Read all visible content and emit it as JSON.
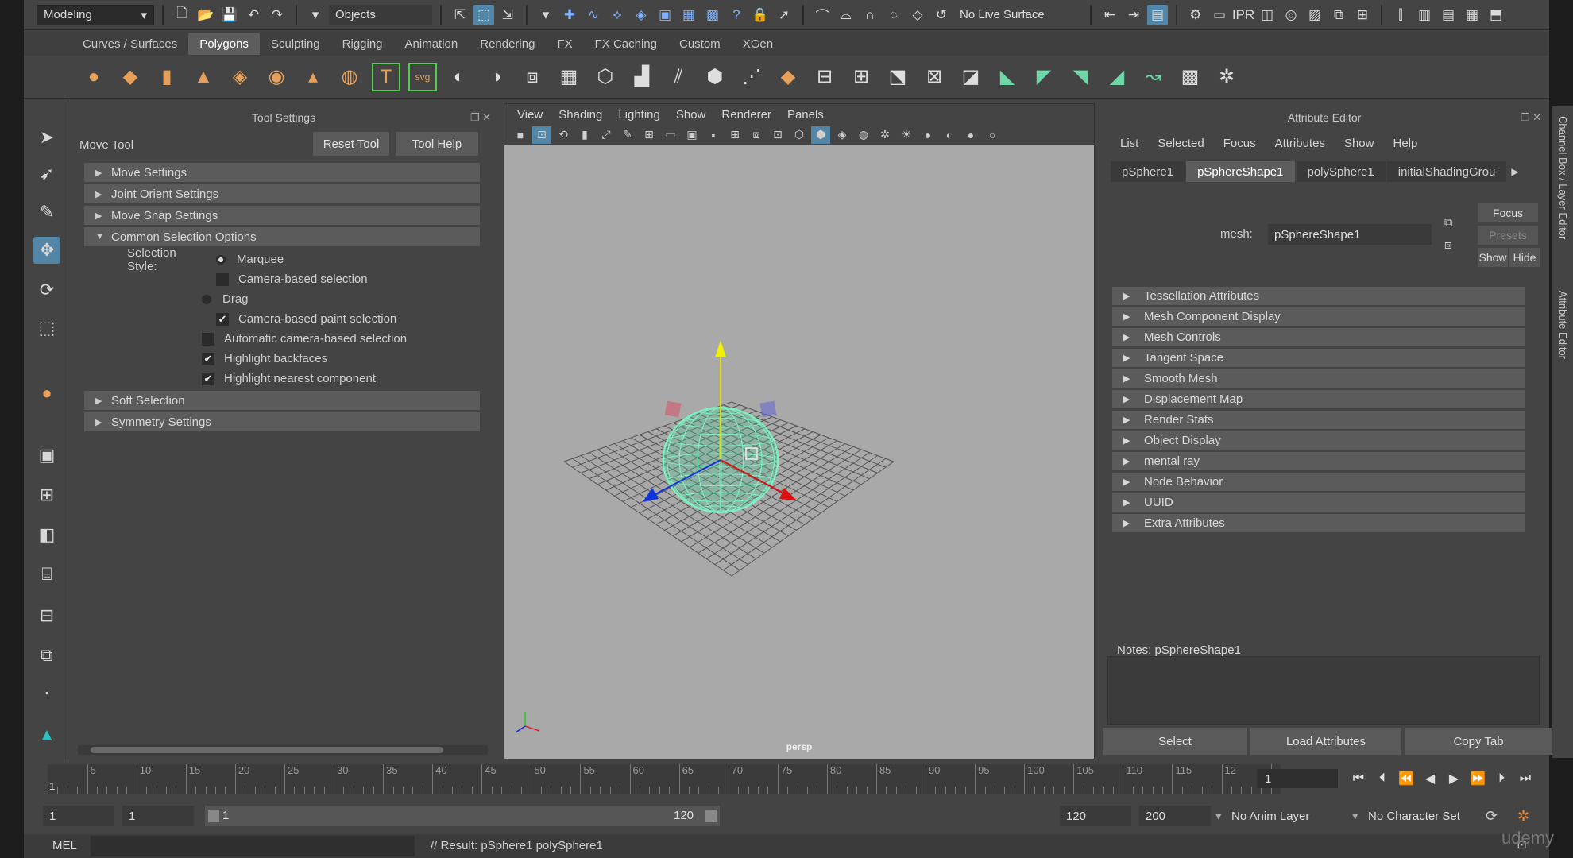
{
  "status_line": {
    "mode": "Modeling",
    "selection_mask": "Objects",
    "live_surface": "No Live Surface"
  },
  "shelf_tabs": [
    "Curves / Surfaces",
    "Polygons",
    "Sculpting",
    "Rigging",
    "Animation",
    "Rendering",
    "FX",
    "FX Caching",
    "Custom",
    "XGen"
  ],
  "active_shelf_tab": "Polygons",
  "tool_settings": {
    "panel_title": "Tool Settings",
    "tool_name": "Move Tool",
    "reset_button": "Reset Tool",
    "help_button": "Tool Help",
    "sections": {
      "move_settings": "Move Settings",
      "joint_orient": "Joint Orient Settings",
      "move_snap": "Move Snap Settings",
      "common_selection": "Common Selection Options",
      "soft_selection": "Soft Selection",
      "symmetry": "Symmetry Settings"
    },
    "selection_style_label": "Selection Style:",
    "marquee": "Marquee",
    "camera_based_selection": "Camera-based selection",
    "drag": "Drag",
    "camera_based_paint": "Camera-based paint selection",
    "automatic_camera": "Automatic camera-based selection",
    "highlight_backfaces": "Highlight backfaces",
    "highlight_nearest": "Highlight nearest component"
  },
  "viewport": {
    "menu": [
      "View",
      "Shading",
      "Lighting",
      "Show",
      "Renderer",
      "Panels"
    ],
    "camera_label": "persp"
  },
  "attribute_editor": {
    "title": "Attribute Editor",
    "menu": [
      "List",
      "Selected",
      "Focus",
      "Attributes",
      "Show",
      "Help"
    ],
    "tabs": [
      "pSphere1",
      "pSphereShape1",
      "polySphere1",
      "initialShadingGrou"
    ],
    "active_tab": "pSphereShape1",
    "mesh_label": "mesh:",
    "mesh_value": "pSphereShape1",
    "focus_button": "Focus",
    "presets_button": "Presets",
    "show_button": "Show",
    "hide_button": "Hide",
    "sections": [
      "Tessellation Attributes",
      "Mesh Component Display",
      "Mesh Controls",
      "Tangent Space",
      "Smooth Mesh",
      "Displacement Map",
      "Render Stats",
      "Object Display",
      "mental ray",
      "Node Behavior",
      "UUID",
      "Extra Attributes"
    ],
    "notes_label": "Notes:  pSphereShape1",
    "select_button": "Select",
    "load_button": "Load Attributes",
    "copy_button": "Copy Tab"
  },
  "side_strip": {
    "channel_box": "Channel Box / Layer Editor",
    "attribute_editor": "Attribute Editor"
  },
  "time_slider": {
    "start_label": "1",
    "ticks": [
      "5",
      "10",
      "15",
      "20",
      "25",
      "30",
      "35",
      "40",
      "45",
      "50",
      "55",
      "60",
      "65",
      "70",
      "75",
      "80",
      "85",
      "90",
      "95",
      "100",
      "105",
      "110",
      "115",
      "12"
    ],
    "current_frame": "1"
  },
  "range_slider": {
    "start_time": "1",
    "playback_start": "1",
    "range_start": "1",
    "range_end": "120",
    "playback_end": "120",
    "end_time": "200",
    "anim_layer": "No Anim Layer",
    "character_set": "No Character Set"
  },
  "command_line": {
    "mel": "MEL",
    "result": "// Result: pSphere1 polySphere1"
  },
  "watermark": "udemy"
}
